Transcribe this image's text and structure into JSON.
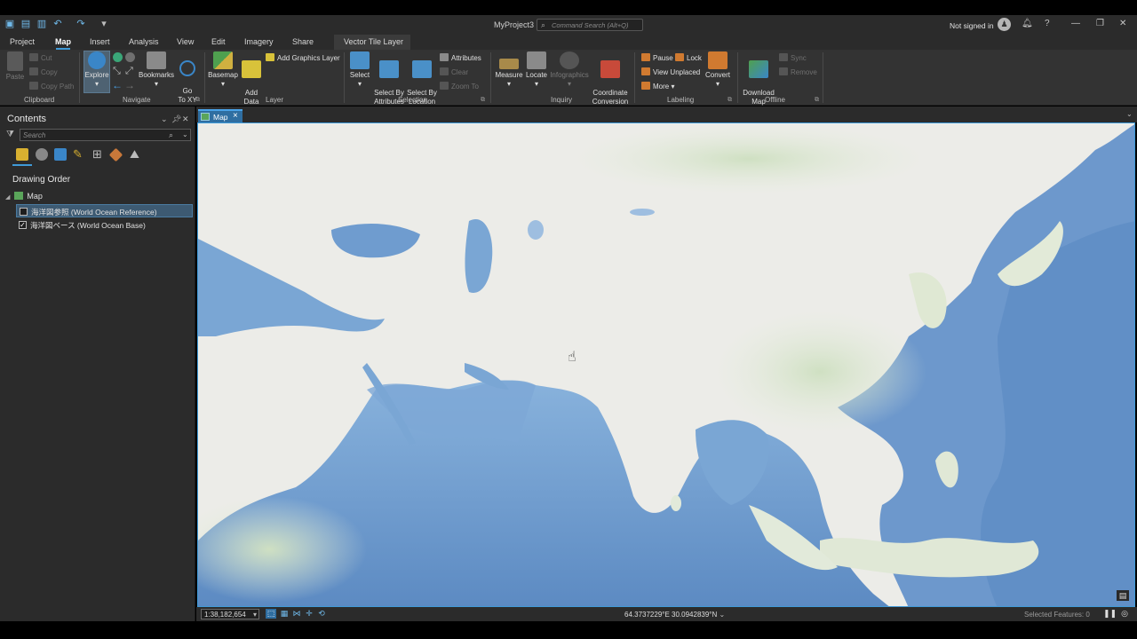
{
  "app": {
    "title": "MyProject3",
    "command_search_placeholder": "Command Search (Alt+Q)",
    "signin": "Not signed in"
  },
  "tabs": [
    "Project",
    "Map",
    "Insert",
    "Analysis",
    "View",
    "Edit",
    "Imagery",
    "Share",
    "Vector Tile Layer"
  ],
  "active_tab": "Map",
  "ribbon": {
    "clipboard": {
      "label": "Clipboard",
      "paste": "Paste",
      "cut": "Cut",
      "copy": "Copy",
      "copy_path": "Copy Path"
    },
    "navigate": {
      "label": "Navigate",
      "explore": "Explore",
      "bookmarks": "Bookmarks",
      "goto": "Go\nTo XY"
    },
    "layer": {
      "label": "Layer",
      "basemap": "Basemap",
      "add_data": "Add\nData",
      "add_graphics": "Add Graphics Layer"
    },
    "selection": {
      "label": "Selection",
      "select": "Select",
      "select_by_attributes": "Select By\nAttributes",
      "select_by_location": "Select By\nLocation",
      "attributes": "Attributes",
      "clear": "Clear",
      "zoom_to": "Zoom To"
    },
    "inquiry": {
      "label": "Inquiry",
      "measure": "Measure",
      "locate": "Locate",
      "infographics": "Infographics",
      "coordinate_conversion": "Coordinate\nConversion"
    },
    "labeling": {
      "label": "Labeling",
      "pause": "Pause",
      "lock": "Lock",
      "view_unplaced": "View Unplaced",
      "more": "More",
      "convert": "Convert"
    },
    "offline": {
      "label": "Offline",
      "download_map": "Download\nMap",
      "sync": "Sync",
      "remove": "Remove"
    }
  },
  "contents": {
    "title": "Contents",
    "search_placeholder": "Search",
    "drawing_order": "Drawing Order",
    "map_name": "Map",
    "layers": [
      {
        "name": "海洋図参照 (World Ocean Reference)",
        "checked": false,
        "selected": true
      },
      {
        "name": "海洋図ベース (World Ocean Base)",
        "checked": true,
        "selected": false
      }
    ]
  },
  "map_view": {
    "tab_label": "Map",
    "scale": "1:38,182,654",
    "coordinates": "64.3737229°E 30.0942839°N",
    "selected_features": "Selected Features: 0"
  },
  "colors": {
    "accent": "#3f9ad8",
    "land": "#eeeeea",
    "ocean": "#7da8d6",
    "deep_ocean": "#5a88c2",
    "vegetation": "#d8e6cf"
  }
}
